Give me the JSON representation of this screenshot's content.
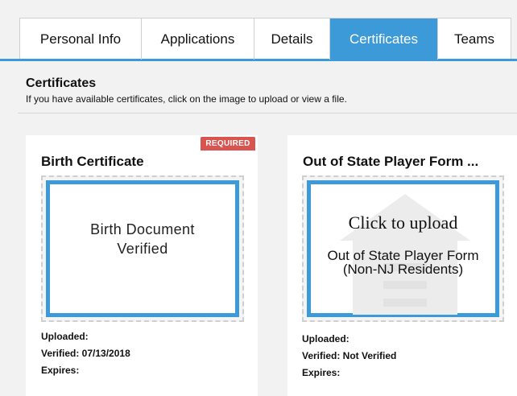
{
  "tabs": [
    {
      "label": "Personal Info"
    },
    {
      "label": "Applications"
    },
    {
      "label": "Details"
    },
    {
      "label": "Certificates",
      "active": true
    },
    {
      "label": "Teams"
    }
  ],
  "section": {
    "title": "Certificates",
    "description": "If you have available certificates, click on the image to upload or view a file."
  },
  "cards": [
    {
      "badge": "REQUIRED",
      "title": "Birth Certificate",
      "preview_line1": "Birth Document",
      "preview_line2": "Verified",
      "uploaded": "Uploaded:",
      "verified": "Verified: 07/13/2018",
      "expires": "Expires:"
    },
    {
      "title": "Out of State Player Form ...",
      "upload_prompt": "Click to upload",
      "preview_line1": "Out of State Player Form",
      "preview_line2": "(Non-NJ Residents)",
      "uploaded": "Uploaded:",
      "verified": "Verified: Not Verified",
      "expires": "Expires:"
    }
  ],
  "colors": {
    "accent": "#3d9ad8",
    "required": "#d9534f",
    "background": "#f2f2f2"
  }
}
